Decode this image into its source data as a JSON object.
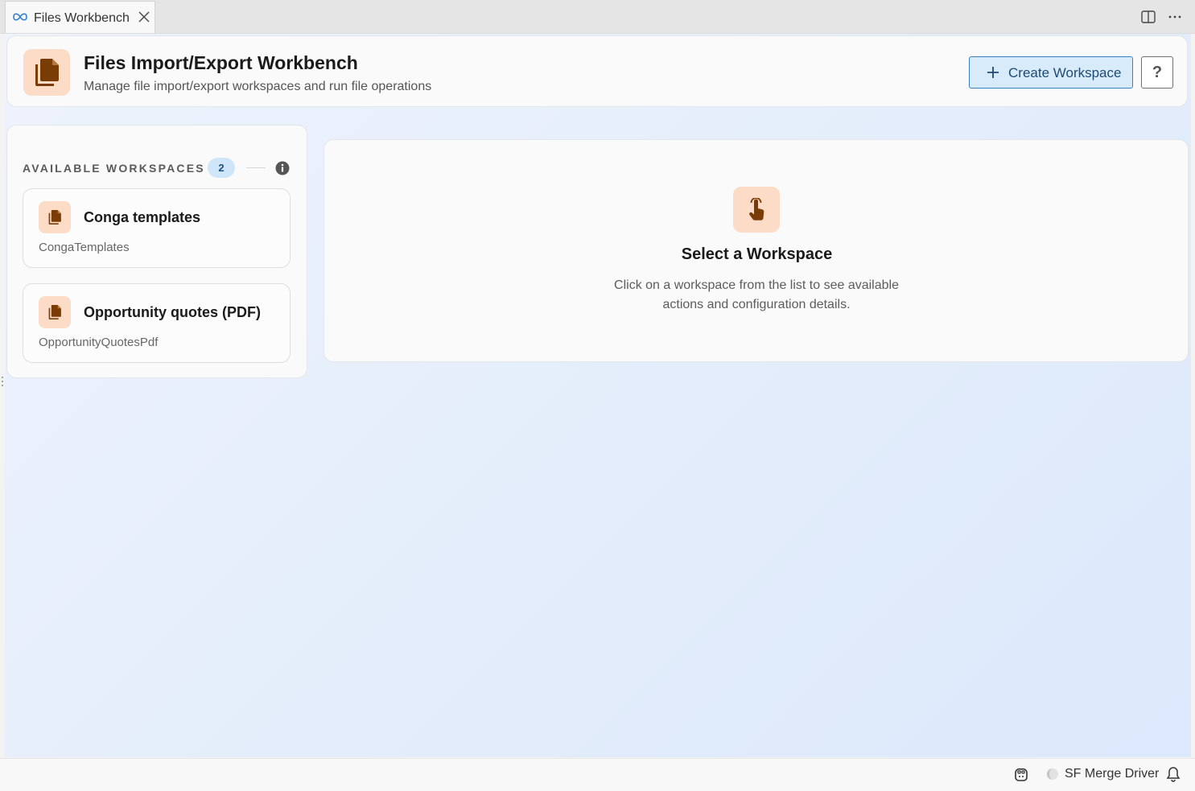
{
  "tab": {
    "label": "Files Workbench"
  },
  "header": {
    "title": "Files Import/Export Workbench",
    "subtitle": "Manage file import/export workspaces and run file operations",
    "create_label": "Create Workspace",
    "help_label": "?"
  },
  "sidebar": {
    "heading": "AVAILABLE WORKSPACES",
    "count": "2",
    "workspaces": [
      {
        "title": "Conga templates",
        "api_name": "CongaTemplates"
      },
      {
        "title": "Opportunity quotes (PDF)",
        "api_name": "OpportunityQuotesPdf"
      }
    ]
  },
  "main": {
    "title": "Select a Workspace",
    "description": "Click on a workspace from the list to see available actions and configuration details."
  },
  "statusbar": {
    "label": "SF Merge Driver"
  },
  "colors": {
    "accent": "#3a7fc1",
    "icon_bg": "#fcdcc7",
    "icon_fg": "#7a3c06",
    "badge_bg": "#cfe5f9"
  },
  "icons": [
    "infinity-icon",
    "close-icon",
    "split-editor-icon",
    "more-icon",
    "files-icon",
    "plus-icon",
    "info-icon",
    "pointer-hand-icon",
    "copilot-icon",
    "spinner-icon",
    "bell-icon"
  ]
}
